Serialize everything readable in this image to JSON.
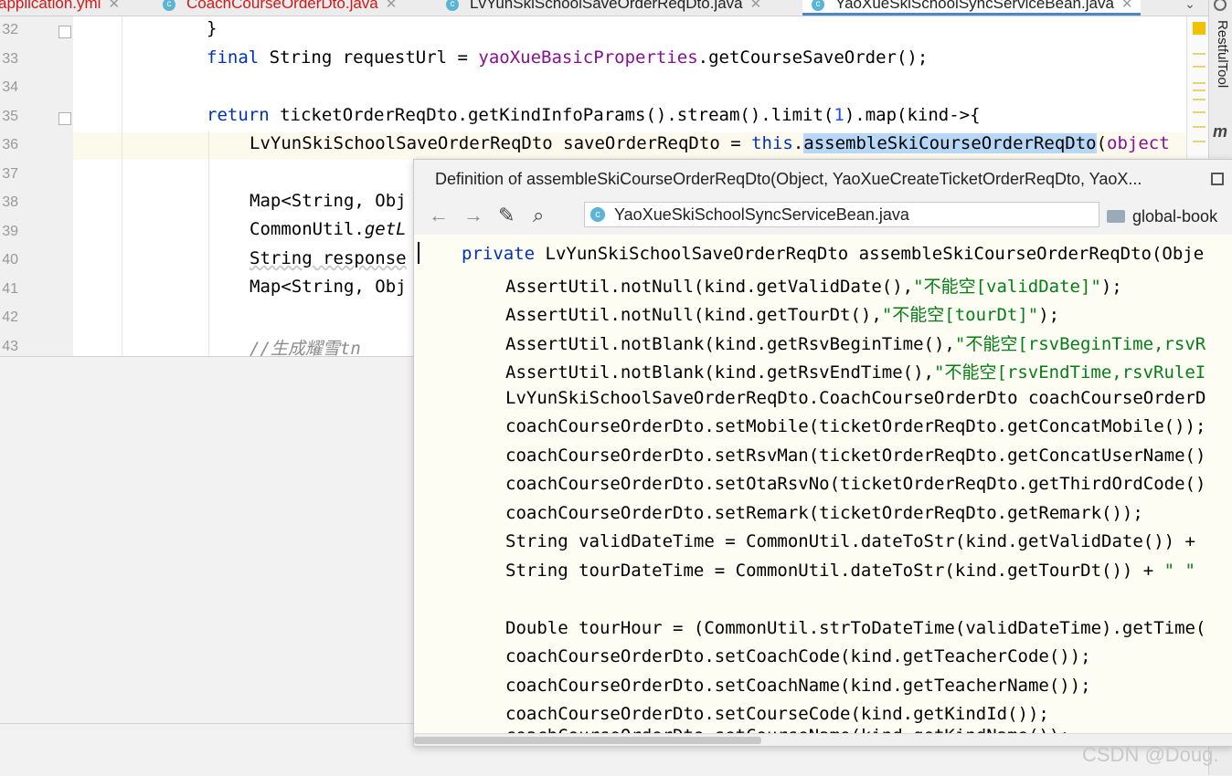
{
  "tabs": [
    {
      "label": "application.yml",
      "type": "yml",
      "error": true,
      "active": false
    },
    {
      "label": "CoachCourseOrderDto.java",
      "type": "java",
      "error": true,
      "active": false
    },
    {
      "label": "LvYunSkiSchoolSaveOrderReqDto.java",
      "type": "java",
      "error": false,
      "active": false
    },
    {
      "label": "YaoXueSkiSchoolSyncServiceBean.java",
      "type": "java",
      "error": false,
      "active": true
    }
  ],
  "editor": {
    "line_numbers": [
      "32",
      "33",
      "34",
      "35",
      "36",
      "37",
      "38",
      "39",
      "40",
      "41",
      "42",
      "43"
    ],
    "lines": {
      "l32": "}",
      "l33_kw": "final",
      "l33_a": " String requestUrl = ",
      "l33_fld": "yaoXueBasicProperties",
      "l33_b": ".getCourseSaveOrder();",
      "l35_kw": "return",
      "l35_a": " ticketOrderReqDto.getKindInfoParams().stream().limit(",
      "l35_num": "1",
      "l35_b": ").map(kind->{",
      "l36_a": "LvYunSkiSchoolSaveOrderReqDto saveOrderReqDto = ",
      "l36_kw": "this",
      "l36_dot": ".",
      "l36_hl": "assembleSkiCourseOrderReqDto",
      "l36_b": "(",
      "l36_obj": "object",
      "l38": "Map<String, Obj",
      "l39_a": "CommonUtil.",
      "l39_it": "getL",
      "l40": "String response",
      "l41": "Map<String, Obj",
      "l43": "//生成耀雪tn"
    }
  },
  "popup": {
    "title": "Definition of assembleSkiCourseOrderReqDto(Object, YaoXueCreateTicketOrderReqDto, YaoX...",
    "file": "YaoXueSkiSchoolSyncServiceBean.java",
    "library": "global-book",
    "toolbar_icons": [
      "back-arrow-icon",
      "forward-arrow-icon",
      "edit-source-icon",
      "find-usages-icon"
    ],
    "code": {
      "p1_kw": "private",
      "p1_a": " LvYunSkiSchoolSaveOrderReqDto assembleSkiCourseOrderReqDto(Obje",
      "p2_a": "AssertUtil.notNull(kind.getValidDate(),",
      "p2_s": "\"不能空[validDate]\"",
      "p2_b": ");",
      "p3_a": "AssertUtil.notNull(kind.getTourDt(),",
      "p3_s": "\"不能空[tourDt]\"",
      "p3_b": ");",
      "p4_a": "AssertUtil.notBlank(kind.getRsvBeginTime(),",
      "p4_s": "\"不能空[rsvBeginTime,rsvR",
      "p5_a": "AssertUtil.notBlank(kind.getRsvEndTime(),",
      "p5_s": "\"不能空[rsvEndTime,rsvRuleI",
      "p6": "LvYunSkiSchoolSaveOrderReqDto.CoachCourseOrderDto coachCourseOrderD",
      "p7": "coachCourseOrderDto.setMobile(ticketOrderReqDto.getConcatMobile());",
      "p8": "coachCourseOrderDto.setRsvMan(ticketOrderReqDto.getConcatUserName()",
      "p9": "coachCourseOrderDto.setOtaRsvNo(ticketOrderReqDto.getThirdOrdCode()",
      "p10": "coachCourseOrderDto.setRemark(ticketOrderReqDto.getRemark());",
      "p11_a": "String validDateTime = CommonUtil.dateToStr(kind.getValidDate()) +",
      "p12_a": "String tourDateTime = CommonUtil.dateToStr(kind.getTourDt()) + ",
      "p12_s": "\" \"",
      "p14": "Double tourHour = (CommonUtil.strToDateTime(validDateTime).getTime(",
      "p15": "coachCourseOrderDto.setCoachCode(kind.getTeacherCode());",
      "p16": "coachCourseOrderDto.setCoachName(kind.getTeacherName());",
      "p17": "coachCourseOrderDto.setCourseCode(kind.getKindId());",
      "p18": "coachCourseOrderDto.setCourseName(kind.getKindName());"
    }
  },
  "side_tool": "RestfulTool",
  "watermark": "CSDN @Doug."
}
